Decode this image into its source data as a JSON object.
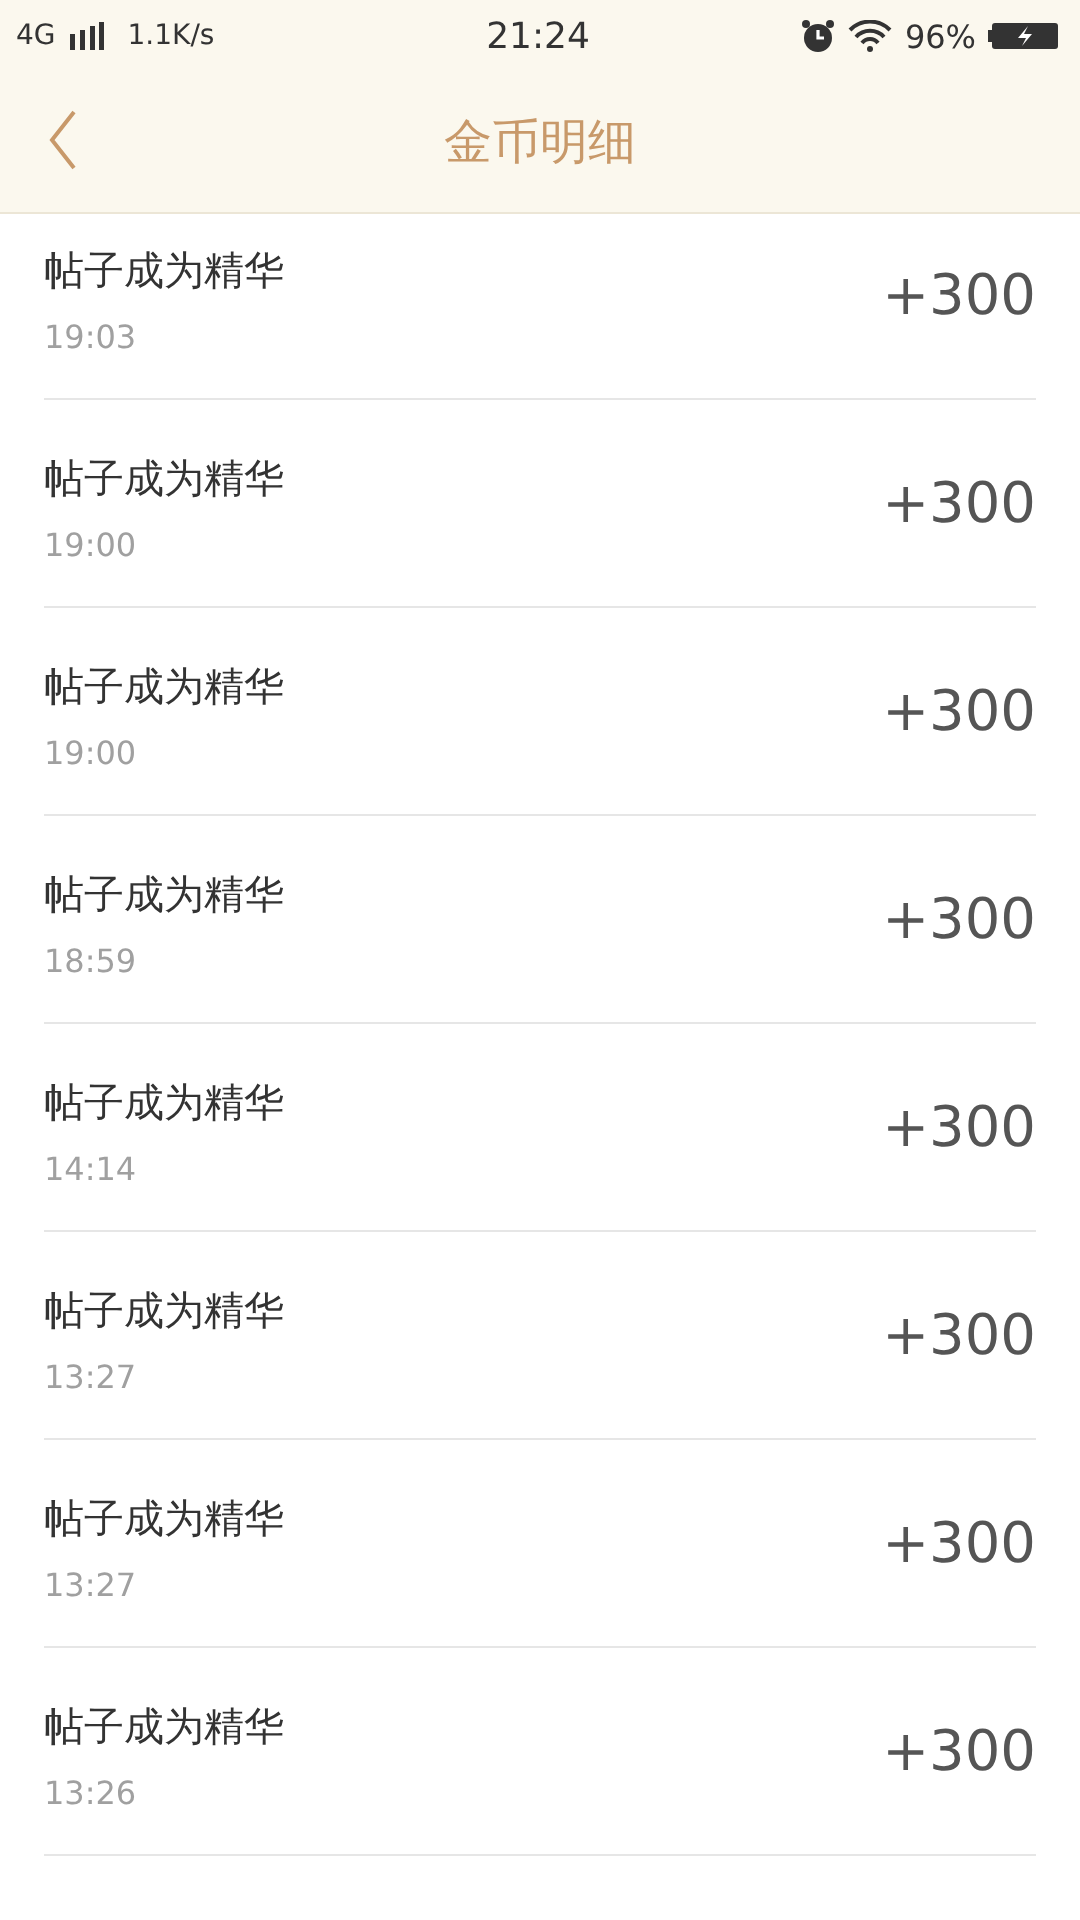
{
  "status_bar": {
    "network": "4G",
    "speed": "1.1K/s",
    "time": "21:24",
    "battery": "96%"
  },
  "header": {
    "title": "金币明细"
  },
  "records": [
    {
      "title": "帖子成为精华",
      "time": "19:03",
      "amount": "+300"
    },
    {
      "title": "帖子成为精华",
      "time": "19:00",
      "amount": "+300"
    },
    {
      "title": "帖子成为精华",
      "time": "19:00",
      "amount": "+300"
    },
    {
      "title": "帖子成为精华",
      "time": "18:59",
      "amount": "+300"
    },
    {
      "title": "帖子成为精华",
      "time": "14:14",
      "amount": "+300"
    },
    {
      "title": "帖子成为精华",
      "time": "13:27",
      "amount": "+300"
    },
    {
      "title": "帖子成为精华",
      "time": "13:27",
      "amount": "+300"
    },
    {
      "title": "帖子成为精华",
      "time": "13:26",
      "amount": "+300"
    }
  ]
}
